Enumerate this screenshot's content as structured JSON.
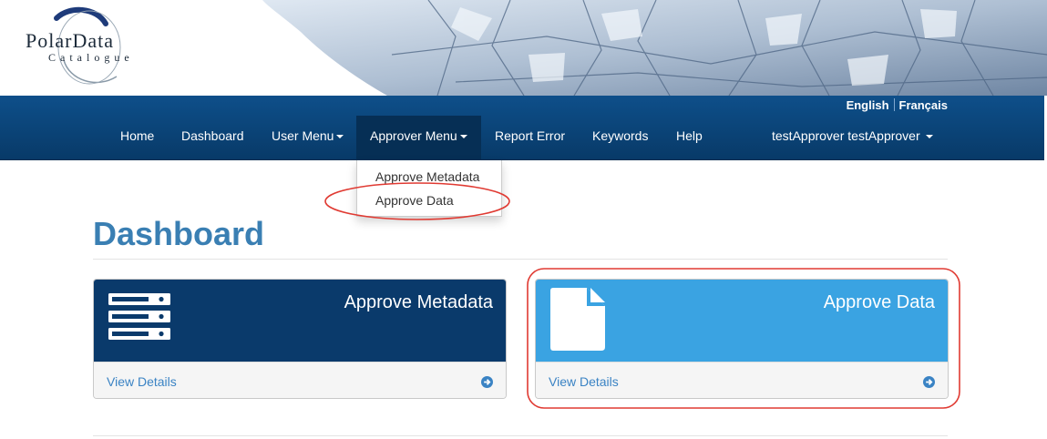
{
  "logo": {
    "line1": "PolarData",
    "line2": "Catalogue"
  },
  "language": {
    "english": "English",
    "french": "Français"
  },
  "nav": {
    "home": "Home",
    "dashboard": "Dashboard",
    "user_menu": "User Menu",
    "approver_menu": "Approver Menu",
    "report_error": "Report Error",
    "keywords": "Keywords",
    "help": "Help",
    "user": "testApprover testApprover"
  },
  "approver_dropdown": {
    "items": [
      "Approve Metadata",
      "Approve Data"
    ]
  },
  "page": {
    "title": "Dashboard"
  },
  "panels": [
    {
      "title": "Approve Metadata",
      "link": "View Details",
      "icon": "server-icon",
      "color": "#0a3a6b"
    },
    {
      "title": "Approve Data",
      "link": "View Details",
      "icon": "document-icon",
      "color": "#3aa3e2"
    }
  ],
  "colors": {
    "navbar": "#0b4680",
    "title": "#3a7fb3",
    "link": "#3a83c4",
    "annotation": "#e03a32"
  },
  "icons": {
    "arrow": "circle-arrow-right-icon",
    "caret": "caret-down-icon"
  }
}
